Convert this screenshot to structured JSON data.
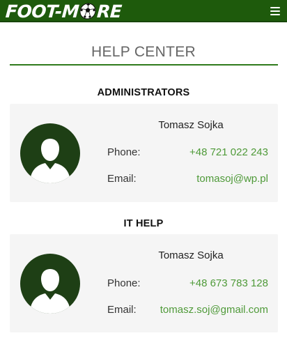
{
  "header": {
    "logo_left": "FOOT-M",
    "logo_right": "RE",
    "menu_icon": "hamburger-menu-icon",
    "background_color": "#1e5a0c"
  },
  "page": {
    "title": "HELP CENTER"
  },
  "sections": [
    {
      "heading": "ADMINISTRATORS",
      "contact": {
        "name": "Tomasz Sojka",
        "phone_label": "Phone:",
        "phone": "+48 721 022 243",
        "email_label": "Email:",
        "email": "tomasoj@wp.pl"
      }
    },
    {
      "heading": "IT HELP",
      "contact": {
        "name": "Tomasz Sojka",
        "phone_label": "Phone:",
        "phone": "+48 673 783 128",
        "email_label": "Email:",
        "email": "tomasz.soj@gmail.com"
      }
    }
  ],
  "colors": {
    "accent_green": "#4f9a39",
    "avatar_bg": "#1e3f15",
    "card_bg": "#f5f5f5"
  }
}
